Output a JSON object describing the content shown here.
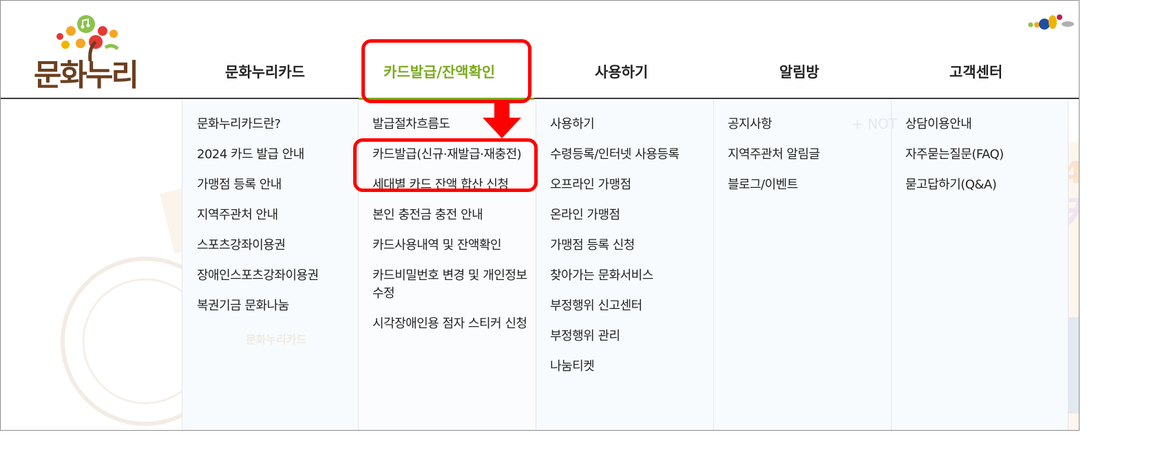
{
  "logo": {
    "text": "문화누리"
  },
  "nav": {
    "items": [
      {
        "label": "문화누리카드"
      },
      {
        "label": "카드발급/잔액확인"
      },
      {
        "label": "사용하기"
      },
      {
        "label": "알림방"
      },
      {
        "label": "고객센터"
      }
    ],
    "active_index": 1
  },
  "menus": {
    "col1": [
      "문화누리카드란?",
      "2024 카드 발급 안내",
      "가맹점 등록 안내",
      "지역주관처 안내",
      "스포츠강좌이용권",
      "장애인스포츠강좌이용권",
      "복권기금 문화나눔"
    ],
    "col2": [
      "발급절차흐름도",
      "카드발급(신규·재발급·재충전)",
      "세대별 카드 잔액 합산 신청",
      "본인 충전금 충전 안내",
      "카드사용내역 및 잔액확인",
      "카드비밀번호 변경 및 개인정보수정",
      "시각장애인용 점자 스티커 신청"
    ],
    "col3": [
      "사용하기",
      "수령등록/인터넷 사용등록",
      "오프라인 가맹점",
      "온라인 가맹점",
      "가맹점 등록 신청",
      "찾아가는 문화서비스",
      "부정행위 신고센터",
      "부정행위 관리",
      "나눔티켓"
    ],
    "col4": [
      "공지사항",
      "지역주관처 알림글",
      "블로그/이벤트"
    ],
    "col5": [
      "상담이용안내",
      "자주묻는질문(FAQ)",
      "묻고답하기(Q&A)"
    ]
  },
  "background": {
    "ghost_label": "문화누리카드",
    "notice_ghost": "+ NOT"
  },
  "colors": {
    "active": "#7bab1c",
    "annotation": "#ff0000",
    "logo_brown": "#6b3f1f"
  }
}
